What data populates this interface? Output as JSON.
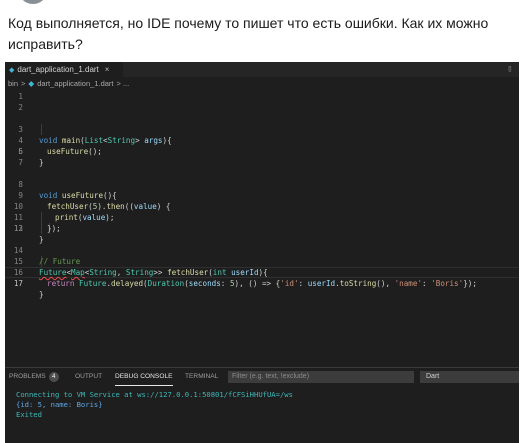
{
  "question": {
    "line1": "Код выполняется, но IDE почему то пишет что есть ошибки. Как их можно",
    "line2": "исправить?"
  },
  "editor": {
    "tab_label": "dart_application_1.dart",
    "tab_close": "×",
    "breadcrumb": {
      "folder": "bin",
      "sep": ">",
      "file": "dart_application_1.dart",
      "tail": "> ..."
    },
    "line_numbers": [
      "1",
      "2",
      "3",
      "4",
      "5",
      "6",
      "7",
      "8",
      "9",
      "10",
      "11",
      "12",
      "13",
      "14",
      "15",
      "16",
      "17"
    ],
    "code": {
      "l3_kw": "void",
      "l3_fn": "main",
      "l3_rest1": "(",
      "l3_type": "List",
      "l3_lt": "<",
      "l3_type2": "String",
      "l3_gt": ">",
      "l3_param": " args",
      "l3_end": "){",
      "l4_fn": "useFuture",
      "l4_end": "();",
      "l5": "}",
      "l8_kw": "void",
      "l8_fn": "useFuture",
      "l8_end": "(){",
      "l9_fn": "fetchUser",
      "l9_p": "(",
      "l9_num": "5",
      "l9_mid": ").",
      "l9_fn2": "then",
      "l9_mid2": "((",
      "l9_param": "value",
      "l9_end": ") {",
      "l10_fn": "print",
      "l10_p": "(",
      "l10_param": "value",
      "l10_end": ");",
      "l11": "});",
      "l12": "}",
      "l14": "// Future",
      "l15_type": "Future",
      "l15_lt": "<",
      "l15_type2": "Map",
      "l15_lt2": "<",
      "l15_type3": "String",
      "l15_comma": ", ",
      "l15_type4": "String",
      "l15_gt": ">> ",
      "l15_fn": "fetchUser",
      "l15_p": "(",
      "l15_kw": "int",
      "l15_param": " userId",
      "l15_end": "){",
      "l16_ret": "return",
      "l16_type": " Future",
      "l16_dot": ".",
      "l16_fn": "delayed",
      "l16_p": "(",
      "l16_type2": "Duration",
      "l16_p2": "(",
      "l16_param": "seconds",
      "l16_colon": ": ",
      "l16_num": "5",
      "l16_mid": "), () => {",
      "l16_str1": "'id'",
      "l16_colon2": ": ",
      "l16_param2": "userId",
      "l16_dot2": ".",
      "l16_fn2": "toString",
      "l16_mid2": "(), ",
      "l16_str2": "'name'",
      "l16_colon3": ": ",
      "l16_str3": "'Boris'",
      "l16_end": "});",
      "l17": "}"
    }
  },
  "panel": {
    "tabs": [
      "PROBLEMS",
      "OUTPUT",
      "DEBUG CONSOLE",
      "TERMINAL"
    ],
    "problems_count": "4",
    "filter_placeholder": "Filter (e.g. text, !exclude)",
    "select_value": "Dart",
    "output": [
      "Connecting to VM Service at ws://127.0.0.1:50801/fCFSiHHUfUA=/ws",
      "{id: 5, name: Boris}",
      "Exited"
    ]
  },
  "colors": {
    "editor_bg": "#1e1e1e",
    "keyword": "#569cd6",
    "function": "#dcdcaa",
    "type": "#4ec9b0",
    "comment": "#6a9955",
    "string": "#ce9178",
    "error_squiggle": "#f14c4c"
  },
  "icons": [
    "dart-file-icon",
    "split-editor-icon",
    "close-icon",
    "chevron-down-icon"
  ]
}
